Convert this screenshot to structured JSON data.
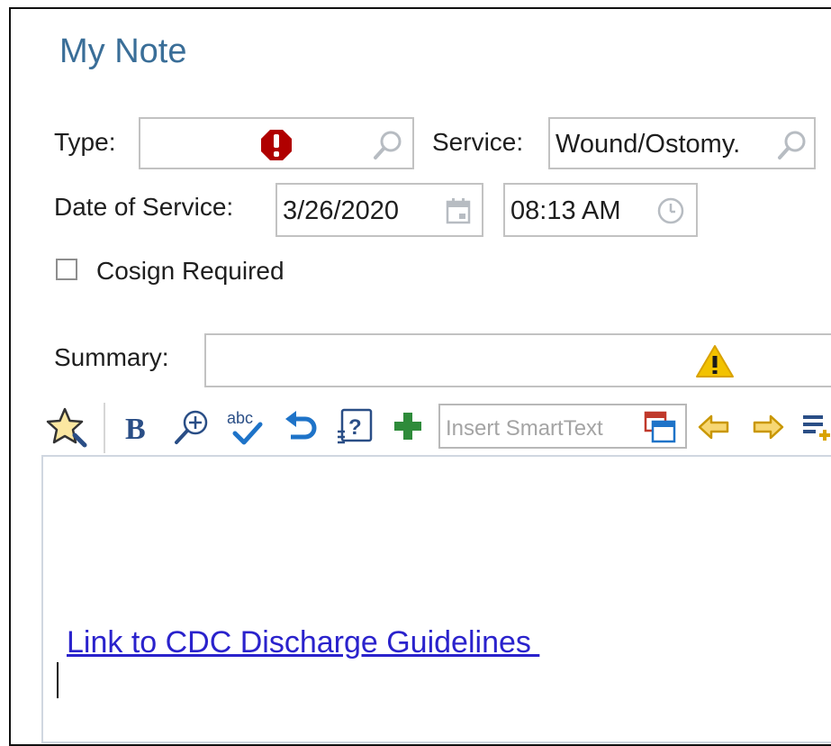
{
  "note": {
    "title": "My Note"
  },
  "form": {
    "type_label": "Type:",
    "type_value": "",
    "service_label": "Service:",
    "service_value": "Wound/Ostomy.",
    "date_label": "Date of Service:",
    "date_value": "3/26/2020",
    "time_value": "08:13 AM",
    "cosign_label": "Cosign Required",
    "cosign_checked": false,
    "summary_label": "Summary:",
    "summary_value": ""
  },
  "toolbar": {
    "smarttext_placeholder": "Insert SmartText",
    "icons": [
      "favorite-star-icon",
      "bold-icon",
      "zoom-in-icon",
      "spellcheck-icon",
      "undo-icon",
      "smartlist-icon",
      "add-icon",
      "insert-smarttext-icon",
      "previous-arrow-icon",
      "next-arrow-icon",
      "insert-list-icon"
    ]
  },
  "editor": {
    "link_text": "Link to CDC Discharge Guidelines "
  },
  "colors": {
    "title": "#3a6e98",
    "required_error": "#b00000",
    "warning": "#f2c200",
    "link": "#2a22cc",
    "add_green": "#2e8b3a",
    "undo_blue": "#1e73c8",
    "arrow_gold": "#d9a200"
  }
}
